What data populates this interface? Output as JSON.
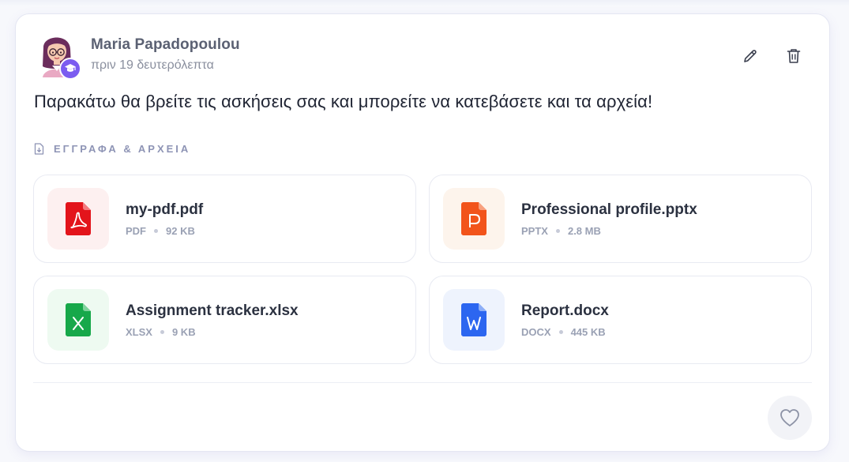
{
  "post": {
    "author": "Maria Papadopoulou",
    "time": "πριν 19 δευτερόλεπτα",
    "message": "Παρακάτω θα βρείτε τις ασκήσεις σας και μπορείτε να κατεβάσετε και τα αρχεία!",
    "section_label": "ΕΓΓΡΑΦΑ & ΑΡΧΕΙΑ"
  },
  "files": [
    {
      "name": "my-pdf.pdf",
      "type": "PDF",
      "size": "92 KB",
      "icon": "pdf-file-icon",
      "color": "#e3141b",
      "bg": "#fdf0f0"
    },
    {
      "name": "Professional profile.pptx",
      "type": "PPTX",
      "size": "2.8 MB",
      "icon": "powerpoint-file-icon",
      "color": "#f2541b",
      "bg": "#fdf4ec"
    },
    {
      "name": "Assignment tracker.xlsx",
      "type": "XLSX",
      "size": "9 KB",
      "icon": "excel-file-icon",
      "color": "#17a84a",
      "bg": "#eefaf1"
    },
    {
      "name": "Report.docx",
      "type": "DOCX",
      "size": "445 KB",
      "icon": "word-file-icon",
      "color": "#2c66f0",
      "bg": "#eef3fd"
    }
  ],
  "colors": {
    "accent": "#7b5cf0",
    "section_label": "#8e94b5"
  }
}
